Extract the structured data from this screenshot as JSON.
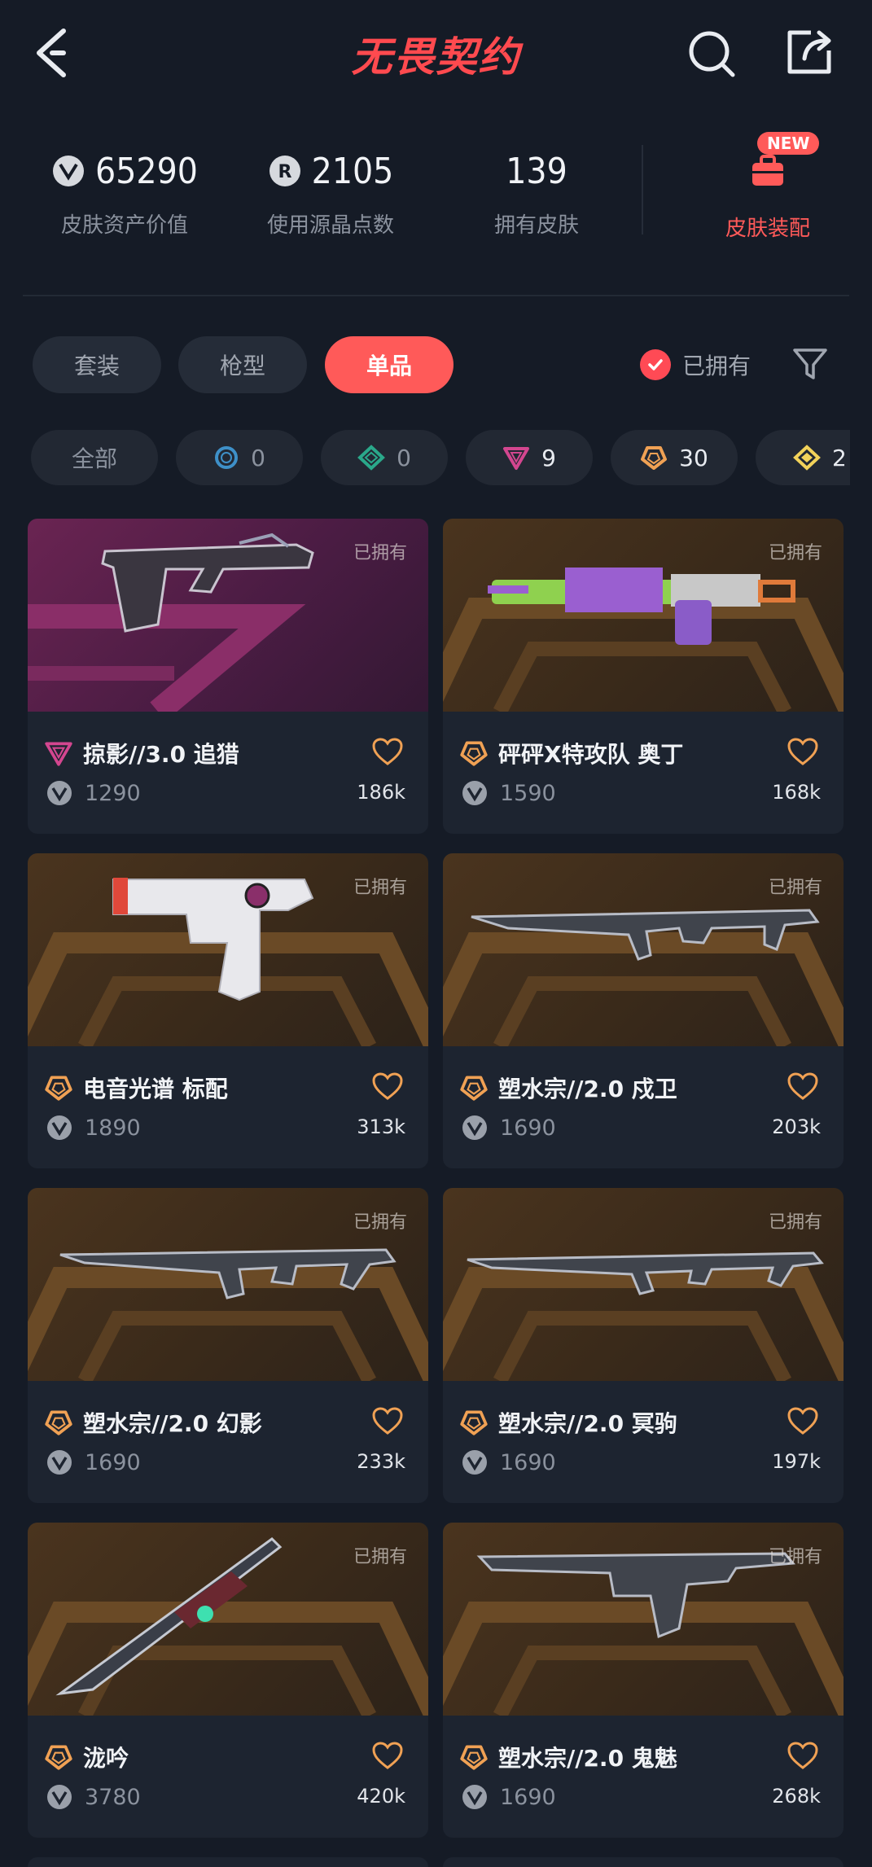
{
  "header": {
    "title": "无畏契约"
  },
  "stats": {
    "asset_value": {
      "value": "65290",
      "label": "皮肤资产价值"
    },
    "radianite_used": {
      "value": "2105",
      "label": "使用源晶点数"
    },
    "skins_owned": {
      "value": "139",
      "label": "拥有皮肤"
    },
    "loadout": {
      "label": "皮肤装配",
      "badge": "NEW"
    }
  },
  "tabs": [
    {
      "label": "套装",
      "active": false
    },
    {
      "label": "枪型",
      "active": false
    },
    {
      "label": "单品",
      "active": true
    }
  ],
  "owned_filter": {
    "label": "已拥有",
    "checked": true
  },
  "tier_chips": [
    {
      "label": "全部"
    },
    {
      "tier": "select",
      "count": "0",
      "color": "#3e90c8"
    },
    {
      "tier": "deluxe",
      "count": "0",
      "color": "#2aa88a"
    },
    {
      "tier": "premium",
      "count": "9",
      "color": "#d3468f"
    },
    {
      "tier": "ultra",
      "count": "30",
      "color": "#f0a154"
    },
    {
      "tier": "exclusive",
      "count": "2",
      "color": "#f2d25a"
    }
  ],
  "skins": [
    {
      "name": "掠影//3.0 追猎",
      "price": "1290",
      "likes": "186k",
      "owned": "已拥有",
      "tier": "premium",
      "tier_color": "#d3468f"
    },
    {
      "name": "砰砰X特攻队 奥丁",
      "price": "1590",
      "likes": "168k",
      "owned": "已拥有",
      "tier": "ultra",
      "tier_color": "#f0a154"
    },
    {
      "name": "电音光谱 标配",
      "price": "1890",
      "likes": "313k",
      "owned": "已拥有",
      "tier": "ultra",
      "tier_color": "#f0a154"
    },
    {
      "name": "塑水宗//2.0 戍卫",
      "price": "1690",
      "likes": "203k",
      "owned": "已拥有",
      "tier": "ultra",
      "tier_color": "#f0a154"
    },
    {
      "name": "塑水宗//2.0 幻影",
      "price": "1690",
      "likes": "233k",
      "owned": "已拥有",
      "tier": "ultra",
      "tier_color": "#f0a154"
    },
    {
      "name": "塑水宗//2.0 冥驹",
      "price": "1690",
      "likes": "197k",
      "owned": "已拥有",
      "tier": "ultra",
      "tier_color": "#f0a154"
    },
    {
      "name": "泷吟",
      "price": "3780",
      "likes": "420k",
      "owned": "已拥有",
      "tier": "ultra",
      "tier_color": "#f0a154"
    },
    {
      "name": "塑水宗//2.0 鬼魅",
      "price": "1690",
      "likes": "268k",
      "owned": "已拥有",
      "tier": "ultra",
      "tier_color": "#f0a154"
    }
  ],
  "colors": {
    "accent": "#ff5a59",
    "background": "#151b26",
    "card": "#1d2430"
  }
}
